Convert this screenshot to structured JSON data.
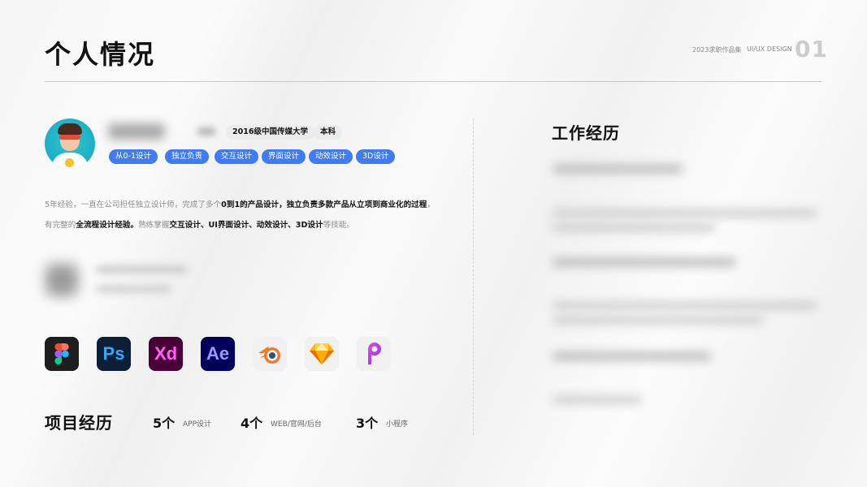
{
  "header": {
    "title": "个人情况",
    "year_label": "2023求职作品集",
    "design_label": "UI/UX DESIGN",
    "page_number": "01"
  },
  "profile": {
    "education": {
      "school": "2016级中国传媒大学",
      "degree": "本科"
    },
    "tags": [
      "从0-1设计",
      "独立负责",
      "交互设计",
      "界面设计",
      "动效设计",
      "3D设计"
    ],
    "tag_color": "#3f7cf2",
    "intro": {
      "p1": "5年经验，一直在公司担任独立设计师，完成了多个",
      "b1": "0到1的产品设计，独立负责多款产品从立项到商业化的过程",
      "p2": "，有完整的",
      "b2": "全流程设计经验。",
      "p3": "熟练掌握",
      "b3": "交互设计、UI界面设计、动效设计、3D设计",
      "p4": "等技能。"
    }
  },
  "tools": [
    {
      "name": "figma-icon",
      "glyph": ""
    },
    {
      "name": "photoshop-icon",
      "glyph": "Ps"
    },
    {
      "name": "xd-icon",
      "glyph": "Xd"
    },
    {
      "name": "after-effects-icon",
      "glyph": "Ae"
    },
    {
      "name": "blender-icon",
      "glyph": ""
    },
    {
      "name": "sketch-icon",
      "glyph": ""
    },
    {
      "name": "pixso-icon",
      "glyph": ""
    }
  ],
  "projects": {
    "title": "项目经历",
    "items": [
      {
        "count": "5个",
        "label": "APP设计"
      },
      {
        "count": "4个",
        "label": "WEB/官网/后台"
      },
      {
        "count": "3个",
        "label": "小程序"
      }
    ]
  },
  "work": {
    "title": "工作经历"
  }
}
